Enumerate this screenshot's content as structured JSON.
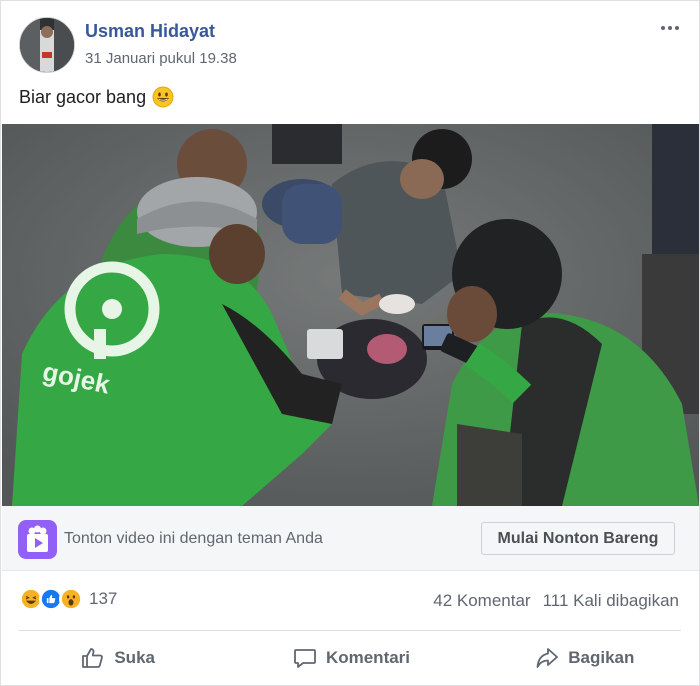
{
  "post": {
    "author": "Usman Hidayat",
    "timestamp": "31 Januari pukul 19.38",
    "caption": "Biar gacor bang",
    "caption_emoji": "grinning-face-emoji",
    "video_jacket_text": "gojek"
  },
  "watch_party": {
    "text": "Tonton video ini dengan teman Anda",
    "button_label": "Mulai Nonton Bareng",
    "icon": "watch-party-icon",
    "icon_color": "#9360f7"
  },
  "reactions": {
    "types": [
      "haha",
      "like",
      "wow"
    ],
    "count": "137"
  },
  "counts": {
    "comments": "42 Komentar",
    "shares": "111 Kali dibagikan"
  },
  "actions": [
    {
      "label": "Suka",
      "icon": "thumbs-up-icon"
    },
    {
      "label": "Komentari",
      "icon": "comment-icon"
    },
    {
      "label": "Bagikan",
      "icon": "share-icon"
    }
  ],
  "colors": {
    "author_link": "#385898",
    "secondary_text": "#606770",
    "gojek_green": "#35a744",
    "like_blue": "#1877f2",
    "reaction_yellow": "#f7b125"
  }
}
